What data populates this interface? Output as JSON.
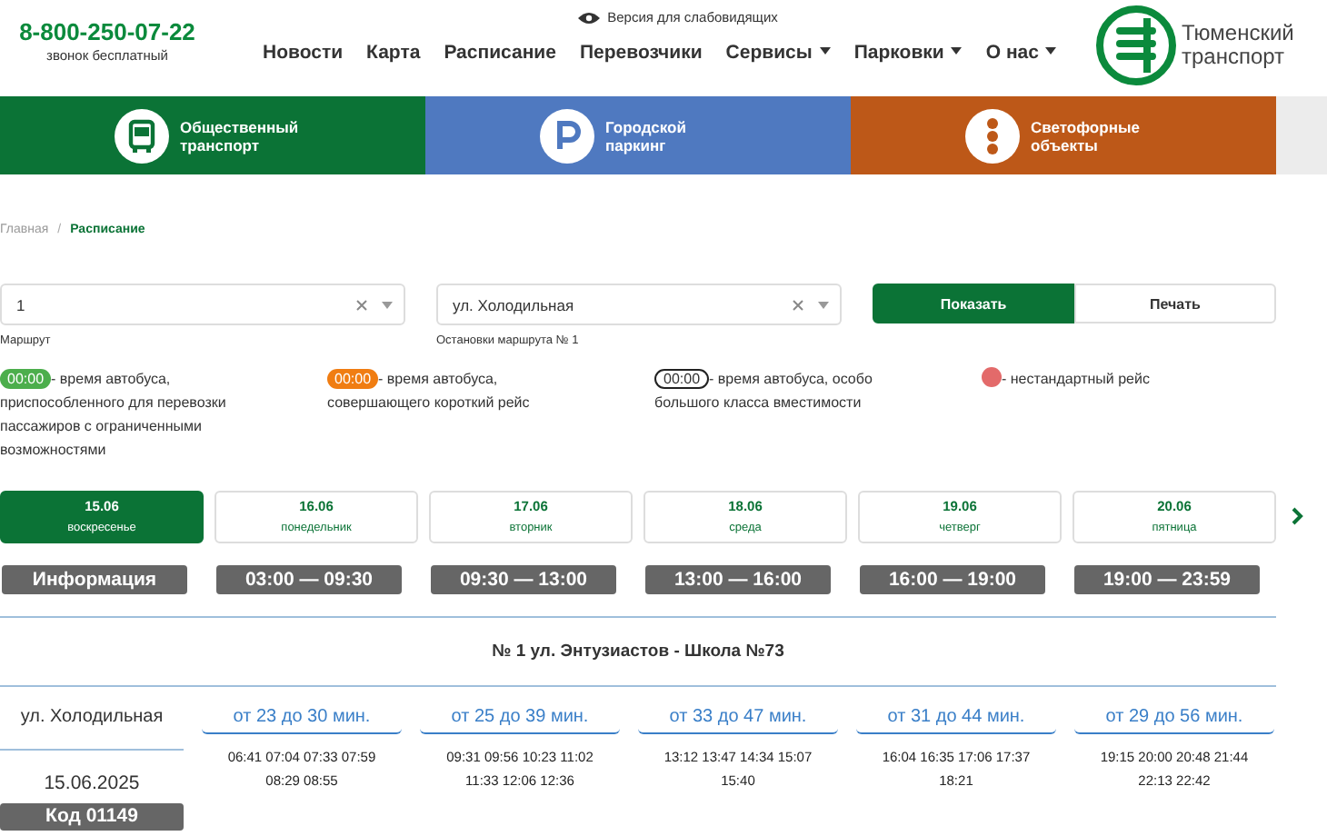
{
  "header": {
    "phone": "8-800-250-07-22",
    "phone_note": "звонок бесплатный",
    "accessibility_link": "Версия для слабовидящих",
    "nav": [
      {
        "label": "Новости",
        "dropdown": false
      },
      {
        "label": "Карта",
        "dropdown": false
      },
      {
        "label": "Расписание",
        "dropdown": false
      },
      {
        "label": "Перевозчики",
        "dropdown": false
      },
      {
        "label": "Сервисы",
        "dropdown": true
      },
      {
        "label": "Парковки",
        "dropdown": true
      },
      {
        "label": "О нас",
        "dropdown": true
      }
    ],
    "logo_lines": [
      "Тюменский",
      "транспорт"
    ]
  },
  "banner": [
    {
      "kind": "bus",
      "lines": [
        "Общественный",
        "транспорт"
      ],
      "color": "#0b7336"
    },
    {
      "kind": "parking",
      "lines": [
        "Городской",
        "паркинг"
      ],
      "color": "#4f79c0"
    },
    {
      "kind": "traffic",
      "lines": [
        "Светофорные",
        "объекты"
      ],
      "color": "#bd5818"
    }
  ],
  "breadcrumb_separator": "/",
  "breadcrumb": [
    {
      "label": "Главная",
      "selected": false
    },
    {
      "label": "Расписание",
      "selected": true
    }
  ],
  "filters": [
    {
      "value": "1",
      "label": "Маршрут"
    },
    {
      "value": "ул. Холодильная",
      "label": "Остановки маршрута № 1"
    }
  ],
  "actions": [
    {
      "label": "Показать",
      "selected": true
    },
    {
      "label": "Печать",
      "selected": false
    }
  ],
  "legend": [
    {
      "kind": "accessible",
      "sample": "00:00",
      "text": "- время автобуса, приспособленного для перевозки пассажиров с ограниченными возможностями"
    },
    {
      "kind": "short",
      "sample": "00:00",
      "text": "- время автобуса, совершающего короткий рейс"
    },
    {
      "kind": "large",
      "sample": "00:00",
      "text": "- время автобуса, особо большого класса вместимости"
    },
    {
      "kind": "nonstandard",
      "text": "- нестандартный рейс"
    }
  ],
  "days": [
    {
      "date": "15.06",
      "weekday": "воскресенье",
      "selected": true
    },
    {
      "date": "16.06",
      "weekday": "понедельник",
      "selected": false
    },
    {
      "date": "17.06",
      "weekday": "вторник",
      "selected": false
    },
    {
      "date": "18.06",
      "weekday": "среда",
      "selected": false
    },
    {
      "date": "19.06",
      "weekday": "четверг",
      "selected": false
    },
    {
      "date": "20.06",
      "weekday": "пятница",
      "selected": false
    }
  ],
  "info_button": "Информация",
  "time_ranges": [
    "03:00 — 09:30",
    "09:30 — 13:00",
    "13:00 — 16:00",
    "16:00 — 19:00",
    "19:00 — 23:59"
  ],
  "route_title": "№ 1 ул. Энтузиастов - Школа №73",
  "stop": {
    "name": "ул. Холодильная",
    "date": "15.06.2025",
    "code": "Код 01149"
  },
  "columns": [
    {
      "interval": "от 23 до 30 мин.",
      "times": [
        "06:41 07:04 07:33 07:59",
        "08:29 08:55"
      ]
    },
    {
      "interval": "от 25 до 39 мин.",
      "times": [
        "09:31 09:56 10:23 11:02",
        "11:33 12:06 12:36"
      ]
    },
    {
      "interval": "от 33 до 47 мин.",
      "times": [
        "13:12 13:47 14:34 15:07",
        "15:40"
      ]
    },
    {
      "interval": "от 31 до 44 мин.",
      "times": [
        "16:04 16:35 17:06 17:37",
        "18:21"
      ]
    },
    {
      "interval": "от 29 до 56 мин.",
      "times": [
        "19:15 20:00 20:48 21:44",
        "22:13 22:42"
      ]
    }
  ]
}
